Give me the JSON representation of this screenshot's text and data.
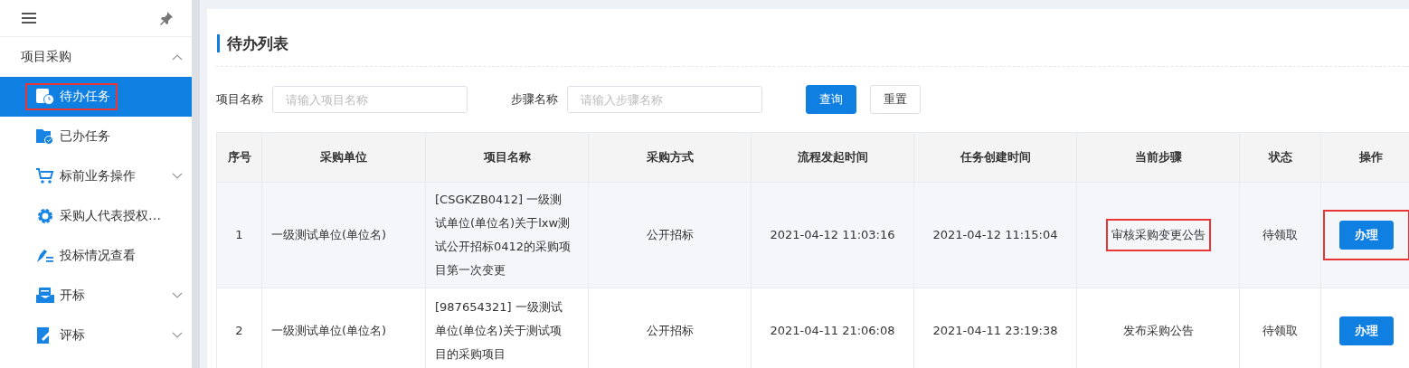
{
  "sidebar": {
    "group": {
      "label": "项目采购",
      "expanded": true
    },
    "items": [
      {
        "label": "待办任务",
        "kind": "link",
        "selected": true,
        "highlighted": true
      },
      {
        "label": "已办任务",
        "kind": "link",
        "selected": false,
        "highlighted": false
      },
      {
        "label": "标前业务操作",
        "kind": "submenu",
        "selected": false,
        "highlighted": false
      },
      {
        "label": "采购人代表授权…",
        "kind": "link",
        "selected": false,
        "highlighted": false
      },
      {
        "label": "投标情况查看",
        "kind": "link",
        "selected": false,
        "highlighted": false
      },
      {
        "label": "开标",
        "kind": "submenu",
        "selected": false,
        "highlighted": false
      },
      {
        "label": "评标",
        "kind": "submenu",
        "selected": false,
        "highlighted": false
      }
    ]
  },
  "panel": {
    "title": "待办列表",
    "filters": [
      {
        "label": "项目名称",
        "placeholder": "请输入项目名称"
      },
      {
        "label": "步骤名称",
        "placeholder": "请输入步骤名称"
      }
    ],
    "buttons": [
      {
        "label": "查询",
        "kind": "primary"
      },
      {
        "label": "重置",
        "kind": "default"
      }
    ],
    "table": {
      "columns": [
        "序号",
        "采购单位",
        "项目名称",
        "采购方式",
        "流程发起时间",
        "任务创建时间",
        "当前步骤",
        "状态",
        "操作"
      ],
      "rows": [
        {
          "index": "1",
          "unit": "一级测试单位(单位名)",
          "project": "[CSGKZB0412] 一级测试单位(单位名)关于lxw测试公开招标0412的采购项目第一次变更",
          "method": "公开招标",
          "started": "2021-04-12 11:03:16",
          "created": "2021-04-12 11:15:04",
          "step": "审核采购变更公告",
          "step_highlighted": true,
          "status": "待领取",
          "action": "办理",
          "action_highlighted": true,
          "selected": true
        },
        {
          "index": "2",
          "unit": "一级测试单位(单位名)",
          "project": "[987654321] 一级测试单位(单位名)关于测试项目的采购项目",
          "method": "公开招标",
          "started": "2021-04-11 21:06:08",
          "created": "2021-04-11 23:19:38",
          "step": "发布采购公告",
          "step_highlighted": false,
          "status": "待领取",
          "action": "办理",
          "action_highlighted": false,
          "selected": false
        }
      ]
    }
  }
}
